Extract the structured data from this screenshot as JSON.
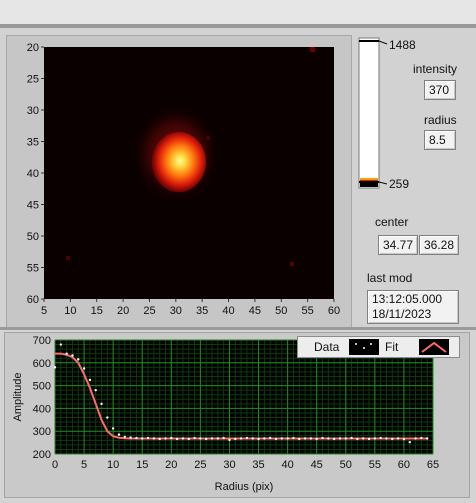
{
  "intensity_label": "intensity",
  "intensity_value": "370",
  "radius_label": "radius",
  "radius_value": "8.5",
  "colorbar": {
    "max_label": "1488",
    "min_label": "259"
  },
  "center_label": "center",
  "center_x": "34.77",
  "center_y": "36.28",
  "last_mod_label": "last mod",
  "last_mod_time": "13:12:05.000",
  "last_mod_date": "18/11/2023",
  "image_x_ticks": [
    "5",
    "10",
    "15",
    "20",
    "25",
    "30",
    "35",
    "40",
    "45",
    "50",
    "55",
    "60"
  ],
  "image_y_ticks": [
    "20",
    "25",
    "30",
    "35",
    "40",
    "45",
    "50",
    "55",
    "60"
  ],
  "legend": {
    "data": "Data",
    "fit": "Fit"
  },
  "chart_data": {
    "type": "scatter",
    "xlabel": "Radius (pix)",
    "ylabel": "Amplitude",
    "xlim": [
      0,
      65
    ],
    "ylim": [
      200,
      700
    ],
    "x_ticks": [
      0,
      5,
      10,
      15,
      20,
      25,
      30,
      35,
      40,
      45,
      50,
      55,
      60,
      65
    ],
    "y_ticks": [
      200,
      300,
      400,
      500,
      600,
      700
    ],
    "grid": true,
    "series": [
      {
        "name": "Data",
        "x": [
          0,
          1,
          2,
          3,
          4,
          5,
          6,
          7,
          8,
          9,
          10,
          11,
          12,
          13,
          14,
          15,
          16,
          17,
          18,
          19,
          20,
          21,
          22,
          23,
          24,
          25,
          26,
          27,
          28,
          29,
          30,
          31,
          32,
          33,
          34,
          35,
          36,
          37,
          38,
          39,
          40,
          41,
          42,
          43,
          44,
          45,
          46,
          47,
          48,
          49,
          50,
          51,
          52,
          53,
          54,
          55,
          56,
          57,
          58,
          59,
          60,
          61,
          62,
          63,
          64
        ],
        "y": [
          580,
          680,
          640,
          632,
          615,
          575,
          525,
          480,
          420,
          360,
          312,
          285,
          275,
          272,
          270,
          268,
          270,
          268,
          266,
          268,
          270,
          266,
          268,
          266,
          270,
          268,
          266,
          268,
          268,
          270,
          262,
          266,
          268,
          270,
          268,
          266,
          268,
          270,
          266,
          268,
          268,
          270,
          266,
          268,
          268,
          266,
          270,
          268,
          266,
          268,
          268,
          270,
          266,
          268,
          266,
          268,
          270,
          268,
          266,
          268,
          265,
          252,
          268,
          270,
          268
        ]
      },
      {
        "name": "Fit",
        "x": [
          0,
          1,
          2,
          3,
          4,
          5,
          6,
          7,
          8,
          9,
          10,
          11,
          12,
          13,
          14,
          15,
          16,
          17,
          18,
          19,
          20,
          22,
          24,
          26,
          28,
          30,
          32,
          34,
          36,
          38,
          40,
          42,
          44,
          46,
          48,
          50,
          52,
          54,
          56,
          58,
          60,
          62,
          64
        ],
        "y": [
          640,
          640,
          635,
          625,
          600,
          550,
          490,
          420,
          350,
          300,
          278,
          271,
          269,
          268,
          268,
          268,
          268,
          268,
          268,
          268,
          268,
          268,
          268,
          268,
          268,
          268,
          268,
          268,
          268,
          268,
          268,
          268,
          268,
          268,
          268,
          268,
          268,
          268,
          268,
          268,
          268,
          268,
          268
        ]
      }
    ]
  }
}
